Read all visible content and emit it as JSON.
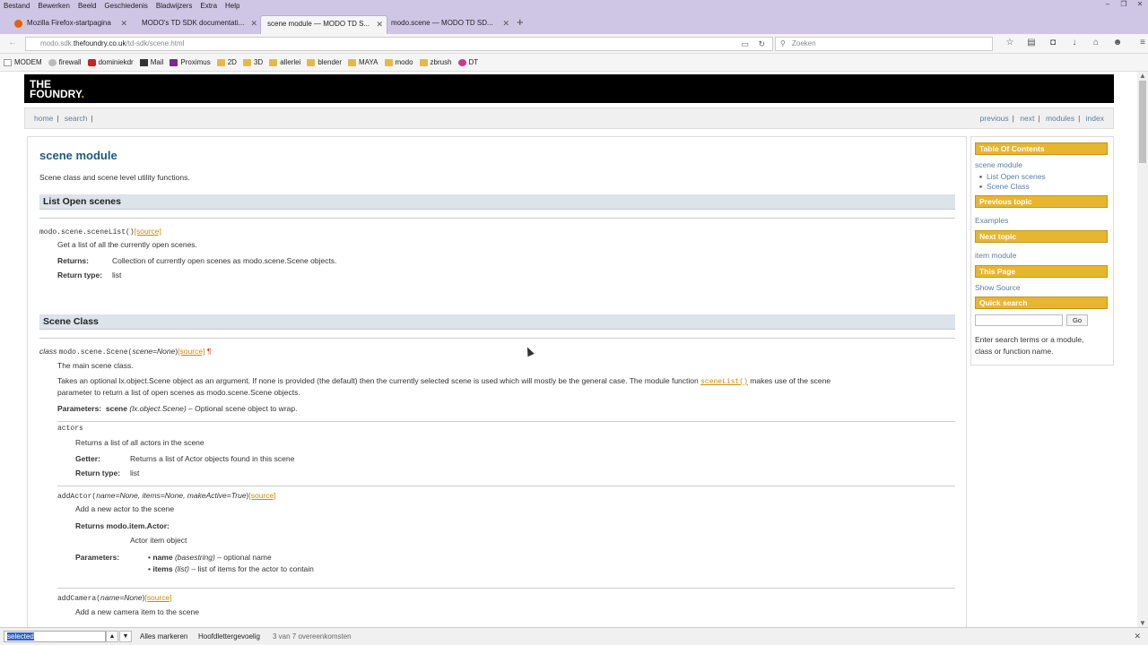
{
  "menubar": [
    "Bestand",
    "Bewerken",
    "Beeld",
    "Geschiedenis",
    "Bladwijzers",
    "Extra",
    "Help"
  ],
  "tabs": [
    {
      "label": "Mozilla Firefox-startpagina"
    },
    {
      "label": "MODO's TD SDK documentati..."
    },
    {
      "label": "scene module — MODO TD S..."
    },
    {
      "label": "modo.scene — MODO TD SD..."
    }
  ],
  "url": {
    "host_pre": "modo.sdk.",
    "host_main": "thefoundry.co.uk",
    "path": "/td-sdk/scene.html"
  },
  "search_placeholder": "Zoeken",
  "bookmarks": [
    {
      "label": "MODEM",
      "icon": "page-icon"
    },
    {
      "label": "firewall",
      "icon": "globe-icon"
    },
    {
      "label": "dominiekdr",
      "icon": "youtube-icon"
    },
    {
      "label": "Mail",
      "icon": "mail-icon"
    },
    {
      "label": "Proximus",
      "icon": "proximus-icon"
    },
    {
      "label": "2D",
      "icon": "folder-icon"
    },
    {
      "label": "3D",
      "icon": "folder-icon"
    },
    {
      "label": "allerlei",
      "icon": "folder-icon"
    },
    {
      "label": "blender",
      "icon": "folder-icon"
    },
    {
      "label": "MAYA",
      "icon": "folder-icon"
    },
    {
      "label": "modo",
      "icon": "folder-icon"
    },
    {
      "label": "zbrush",
      "icon": "folder-icon"
    },
    {
      "label": "DT",
      "icon": "circle-icon"
    }
  ],
  "logo": {
    "line1": "THE",
    "line2": "FOUNDRY",
    "dot": "."
  },
  "relbar": {
    "home": "home",
    "search": "search",
    "previous": "previous",
    "next": "next",
    "modules": "modules",
    "index": "index",
    "sep": "|"
  },
  "doc": {
    "title": "scene module",
    "intro": "Scene class and scene level utility functions.",
    "sec1": "List Open scenes",
    "scenelist_sig": "modo.scene.sceneList()",
    "source": "[source]",
    "scenelist_desc": "Get a list of all the currently open scenes.",
    "returns_label": "Returns:",
    "returns_val": "Collection of currently open scenes as modo.scene.Scene objects.",
    "rtype_label": "Return type:",
    "rtype_val": "list",
    "sec2": "Scene Class",
    "class_kw": "class",
    "class_name": "modo.scene.Scene(",
    "class_arg": "scene=None",
    "class_close": ")",
    "pilcrow": "¶",
    "class_desc1": "The main scene class.",
    "class_desc2a": "Takes an optional lx.object.Scene object as an argument. If none is provided (the default) then the currently selected scene is used which will mostly be the general case. The module function ",
    "class_desc2link": "sceneList()",
    "class_desc2b": " makes use of the scene",
    "class_desc3": "parameter to return a list of open scenes as modo.scene.Scene objects.",
    "params_label": "Parameters:",
    "params_name": "scene",
    "params_type": "(lx.object.Scene)",
    "params_desc": " – Optional scene object to wrap.",
    "actors_sig": "actors",
    "actors_desc": "Returns a list of all actors in the scene",
    "getter_label": "Getter:",
    "getter_val": "Returns a list of Actor objects found in this scene",
    "addactor_sig": "addActor(",
    "addactor_args": "name=None, items=None, makeActive=True",
    "addactor_desc": "Add a new actor to the scene",
    "returns_actor": "Returns modo.item.Actor:",
    "actor_item": "Actor item object",
    "p1_name": "name",
    "p1_type": "(basestring)",
    "p1_desc": " – optional name",
    "p2_name": "items",
    "p2_type": "(list)",
    "p2_desc": " – list of items for the actor to contain",
    "addcamera_sig": "addCamera(",
    "addcamera_args": "name=None",
    "addcamera_desc": "Add a new camera item to the scene"
  },
  "sidebar": {
    "toc": "Table Of Contents",
    "toc_root": "scene module",
    "toc_1": "List Open scenes",
    "toc_2": "Scene Class",
    "prev_head": "Previous topic",
    "prev_link": "Examples",
    "next_head": "Next topic",
    "next_link": "item module",
    "page_head": "This Page",
    "page_link": "Show Source",
    "qs_head": "Quick search",
    "go": "Go",
    "qs_hint1": "Enter search terms or a module,",
    "qs_hint2": "class or function name."
  },
  "findbar": {
    "query": "selected",
    "highlight_all": "Alles markeren",
    "match_case": "Hoofdlettergevoelig",
    "status": "3 van 7 overeenkomsten"
  }
}
